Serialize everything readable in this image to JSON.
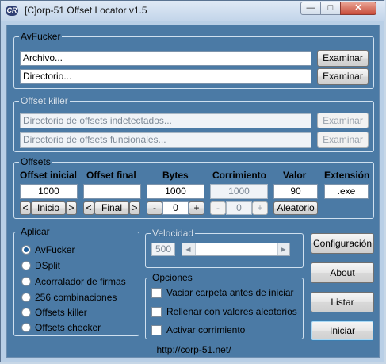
{
  "window": {
    "icon_text": "CR",
    "title": "[C]orp-51 Offset Locator v1.5",
    "minimize": "—",
    "maximize": "□",
    "close": "✕"
  },
  "avfucker": {
    "title": "AvFucker",
    "file_value": "Archivo...",
    "dir_value": "Directorio...",
    "browse_file": "Examinar",
    "browse_dir": "Examinar"
  },
  "offset_killer": {
    "title": "Offset killer",
    "undetected_value": "Directorio de offsets indetectados...",
    "functional_value": "Directorio de offsets funcionales...",
    "browse_undetected": "Examinar",
    "browse_functional": "Examinar"
  },
  "offsets": {
    "title": "Offsets",
    "headers": [
      "Offset inicial",
      "Offset final",
      "Bytes",
      "Corrimiento",
      "Valor",
      "Extensión"
    ],
    "offset_inicial": "1000",
    "offset_final": "",
    "bytes": "1000",
    "corrimiento": "1000",
    "valor": "90",
    "extension": ".exe",
    "prev": "<",
    "next": ">",
    "inicio": "Inicio",
    "final": "Final",
    "minus": "-",
    "plus": "+",
    "bytes_step": "0",
    "corr_step": "0",
    "aleatorio": "Aleatorio"
  },
  "aplicar": {
    "title": "Aplicar",
    "options": [
      "AvFucker",
      "DSplit",
      "Acorralador de firmas",
      "256 combinaciones",
      "Offsets killer",
      "Offsets checker"
    ],
    "selected": "AvFucker"
  },
  "velocidad": {
    "title": "Velocidad",
    "value": "500",
    "left_arrow": "◀",
    "right_arrow": "▶"
  },
  "opciones": {
    "title": "Opciones",
    "items": [
      "Vaciar carpeta antes de iniciar",
      "Rellenar con valores aleatorios",
      "Activar corrimiento"
    ]
  },
  "buttons": {
    "config": "Configuración",
    "about": "About",
    "listar": "Listar",
    "iniciar": "Iniciar"
  },
  "footer": {
    "url": "http://corp-51.net/"
  }
}
